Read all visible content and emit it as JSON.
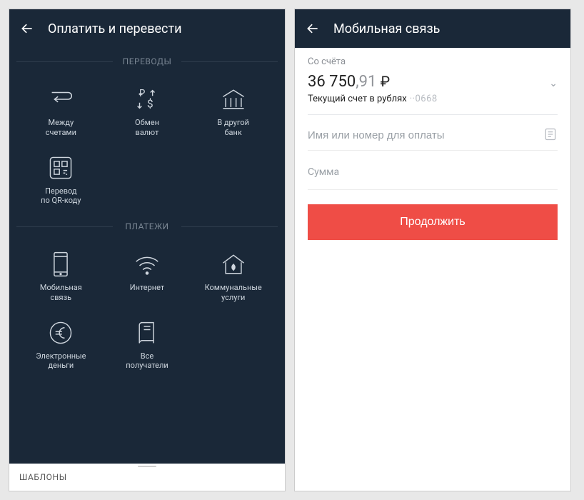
{
  "left": {
    "header": {
      "title": "Оплатить и перевести"
    },
    "sections": {
      "transfers": {
        "label": "ПЕРЕВОДЫ",
        "tiles": {
          "between": "Между\nсчетами",
          "exchange": "Обмен\nвалют",
          "otherBank": "В другой\nбанк",
          "qr": "Перевод\nпо QR-коду"
        }
      },
      "payments": {
        "label": "ПЛАТЕЖИ",
        "tiles": {
          "mobile": "Мобильная\nсвязь",
          "internet": "Интернет",
          "utilities": "Коммунальные\nуслуги",
          "emoney": "Электронные\nденьги",
          "all": "Все\nполучатели"
        }
      }
    },
    "sheet": {
      "title": "ШАБЛОНЫ"
    }
  },
  "right": {
    "header": {
      "title": "Мобильная связь"
    },
    "account": {
      "caption": "Со счёта",
      "balance_int": "36 750",
      "balance_dec": ",91",
      "currency": "₽",
      "subline": "Текущий счет в рублях",
      "mask": "··0668"
    },
    "fields": {
      "recipient_placeholder": "Имя или номер для оплаты",
      "amount_label": "Сумма"
    },
    "cta": "Продолжить"
  }
}
